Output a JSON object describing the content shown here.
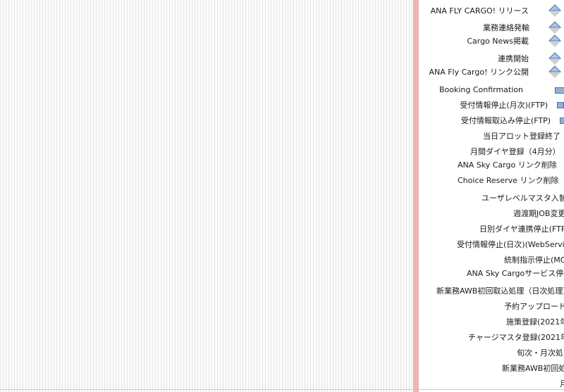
{
  "tasks": [
    {
      "label": "ANA FLY CARGO! リリース",
      "marker": "milestone-icon"
    },
    {
      "label": "業務連絡発輸",
      "marker": "milestone-icon"
    },
    {
      "label": "Cargo News掲載",
      "marker": "milestone-icon"
    },
    {
      "label": "連携開始",
      "marker": "milestone-icon"
    },
    {
      "label": "ANA Fly Cargo! リンク公開",
      "marker": "milestone-icon"
    },
    {
      "label": "Booking Confirmation",
      "marker": "task-bar-icon"
    },
    {
      "label": "受付情報停止(月次)(FTP)",
      "marker": "task-bar-icon"
    },
    {
      "label": "受付情報取込み停止(FTP)",
      "marker": "task-bar-icon"
    },
    {
      "label": "当日アロット登録終了"
    },
    {
      "label": "月間ダイヤ登録（4月分）"
    },
    {
      "label": "ANA Sky Cargo リンク削除"
    },
    {
      "label": "Choice Reserve リンク削除"
    },
    {
      "label": "ユーザレベルマスタ入替"
    },
    {
      "label": "週渡期JOB変更"
    },
    {
      "label": "日別ダイヤ連携停止(FTP)"
    },
    {
      "label": "受付情報停止(日次)(WebService)"
    },
    {
      "label": "統制指示停止(MQ)"
    },
    {
      "label": "ANA Sky Cargoサービス停止"
    },
    {
      "label": "新業務AWB初回取込処理（日次処理）"
    },
    {
      "label": "予約アップロード"
    },
    {
      "label": "施策登録(2021年"
    },
    {
      "label": "チャージマスタ登録(2021年"
    },
    {
      "label": "旬次・月次処"
    },
    {
      "label": "新業務AWB初回処"
    },
    {
      "label": "月"
    }
  ],
  "colors": {
    "today_line": "#f0b3b6",
    "milestone_fill": "#a9c4ee",
    "milestone_stroke": "#4f72a8",
    "bar_fill": "#8fb0dc"
  }
}
